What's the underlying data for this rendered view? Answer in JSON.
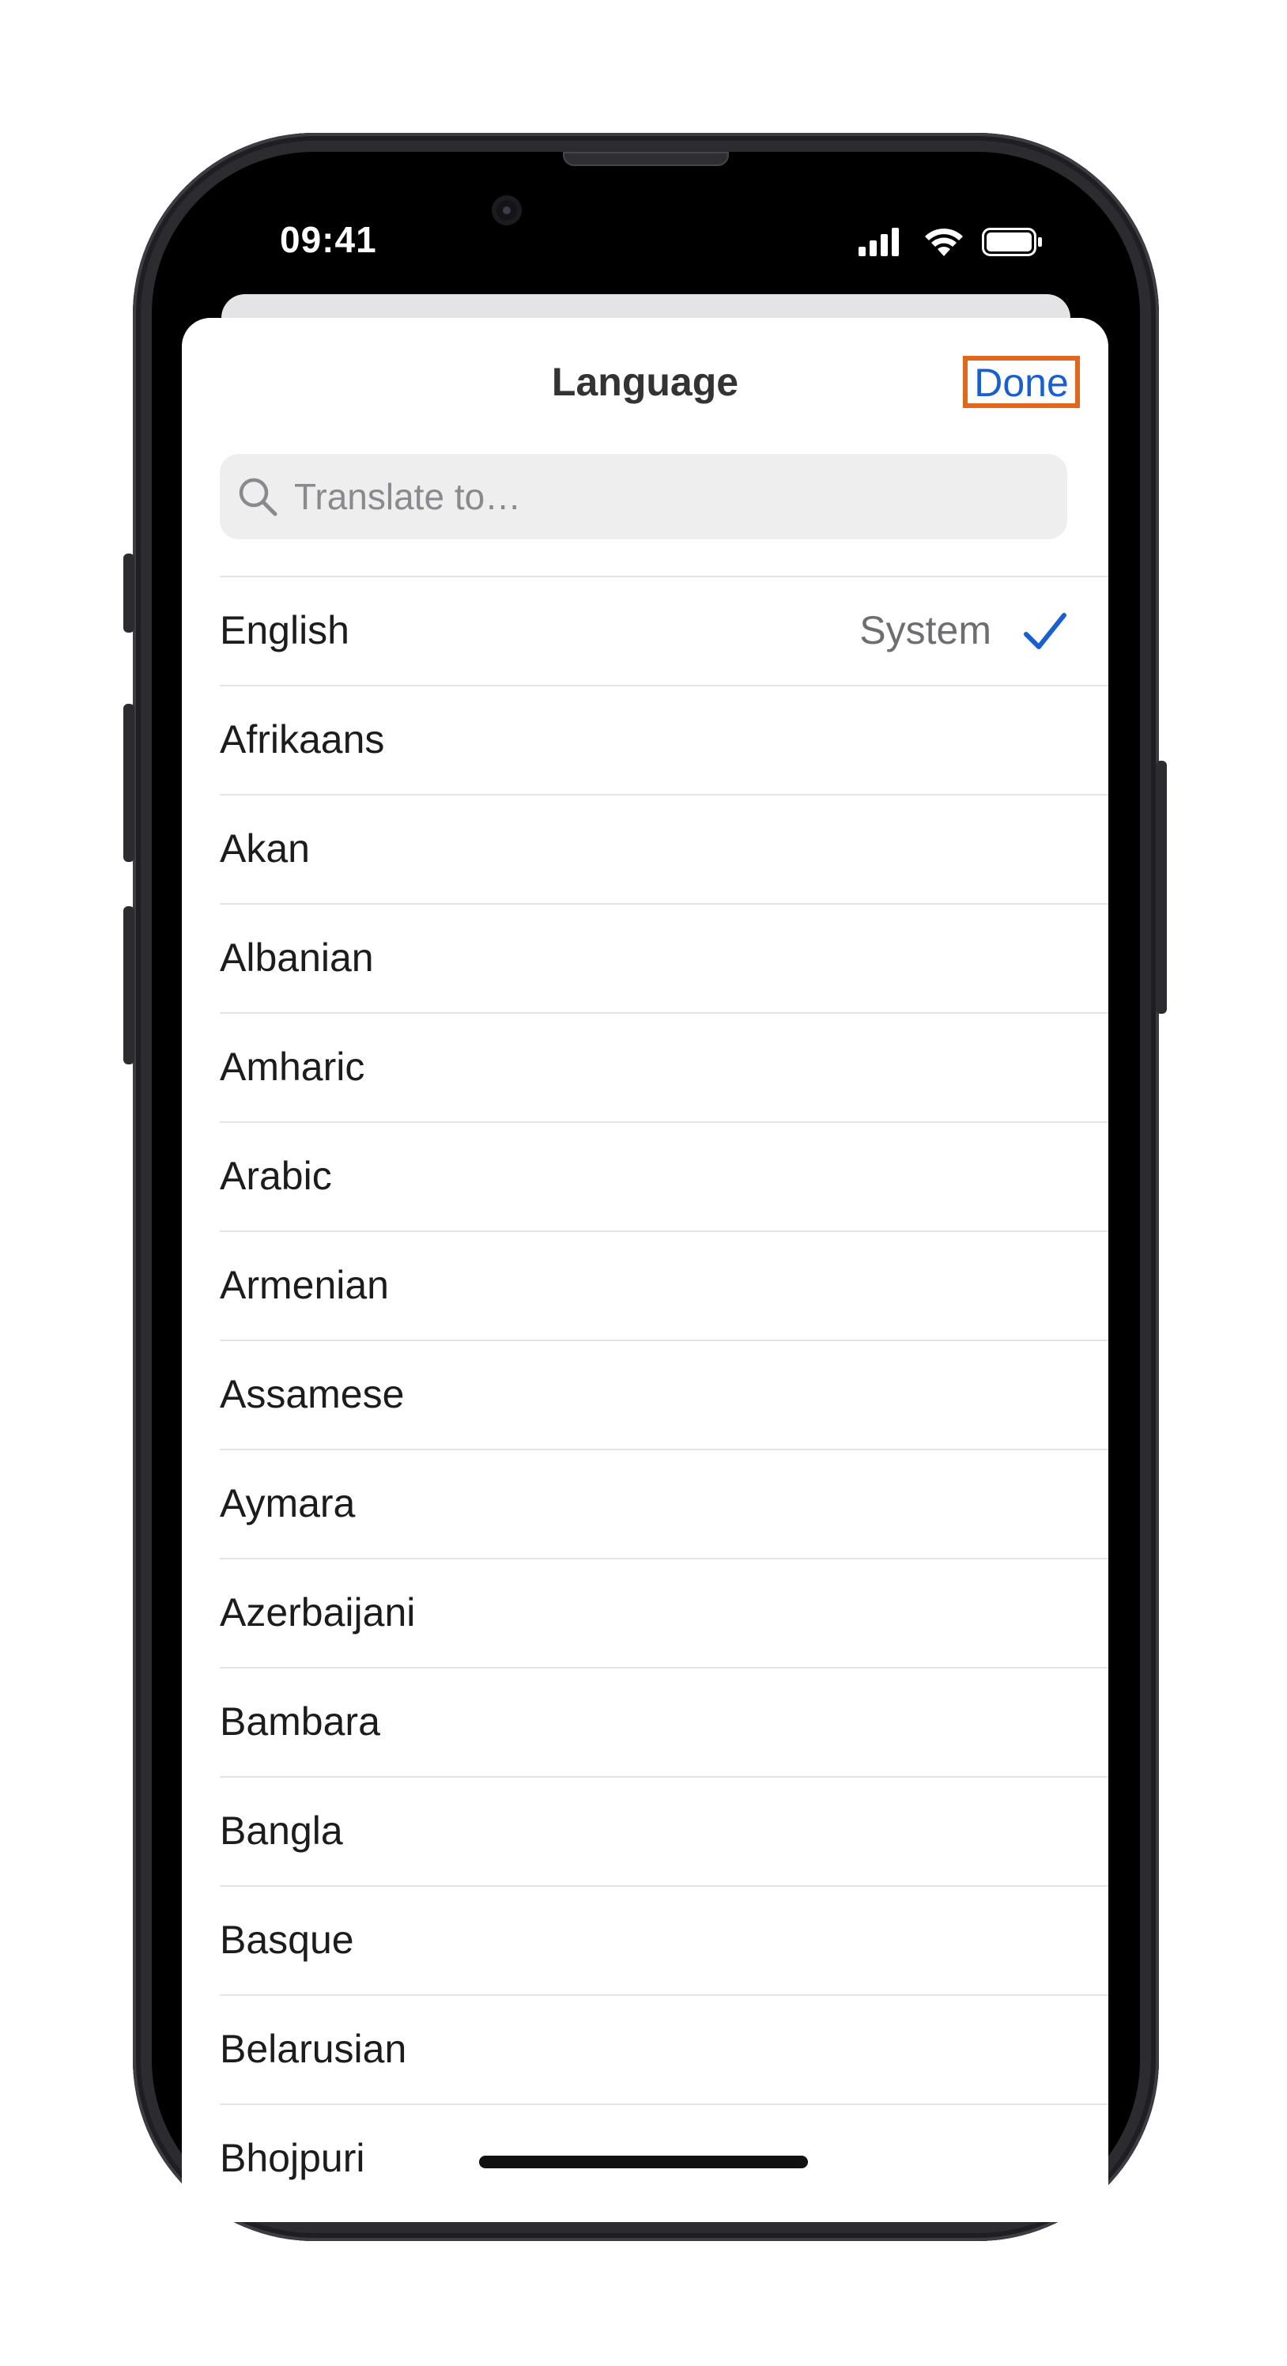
{
  "status_bar": {
    "time": "09:41"
  },
  "sheet": {
    "title": "Language",
    "done_label": "Done",
    "search": {
      "placeholder": "Translate to…"
    },
    "languages": [
      {
        "label": "English",
        "note": "System",
        "selected": true
      },
      {
        "label": "Afrikaans"
      },
      {
        "label": "Akan"
      },
      {
        "label": "Albanian"
      },
      {
        "label": "Amharic"
      },
      {
        "label": "Arabic"
      },
      {
        "label": "Armenian"
      },
      {
        "label": "Assamese"
      },
      {
        "label": "Aymara"
      },
      {
        "label": "Azerbaijani"
      },
      {
        "label": "Bambara"
      },
      {
        "label": "Bangla"
      },
      {
        "label": "Basque"
      },
      {
        "label": "Belarusian"
      },
      {
        "label": "Bhojpuri"
      }
    ]
  },
  "colors": {
    "accent": "#1a5fd0",
    "highlight": "#e2661c"
  }
}
